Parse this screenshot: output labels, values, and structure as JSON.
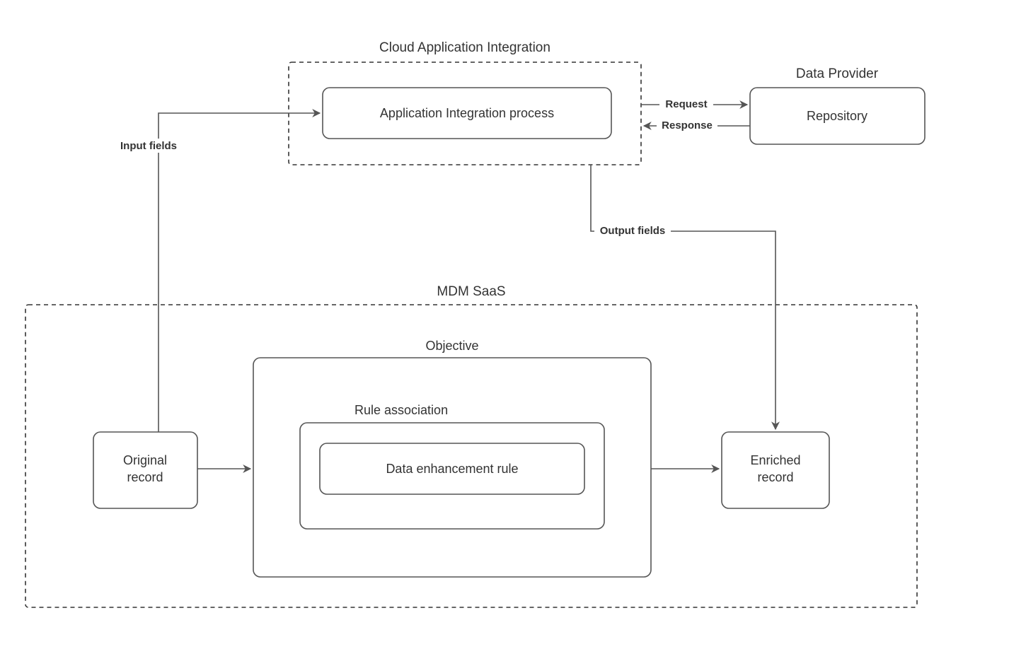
{
  "sections": {
    "cloud_integration_title": "Cloud Application Integration",
    "data_provider_title": "Data Provider",
    "mdm_saas_title": "MDM SaaS"
  },
  "boxes": {
    "app_integration_process": "Application Integration process",
    "repository": "Repository",
    "original_record_line1": "Original",
    "original_record_line2": "record",
    "enriched_record_line1": "Enriched",
    "enriched_record_line2": "record",
    "objective_title": "Objective",
    "rule_association_title": "Rule association",
    "data_enhancement_rule": "Data enhancement rule"
  },
  "edges": {
    "input_fields": "Input fields",
    "output_fields": "Output fields",
    "request": "Request",
    "response": "Response"
  },
  "style": {
    "stroke": "#555555",
    "dash": "6,5"
  }
}
